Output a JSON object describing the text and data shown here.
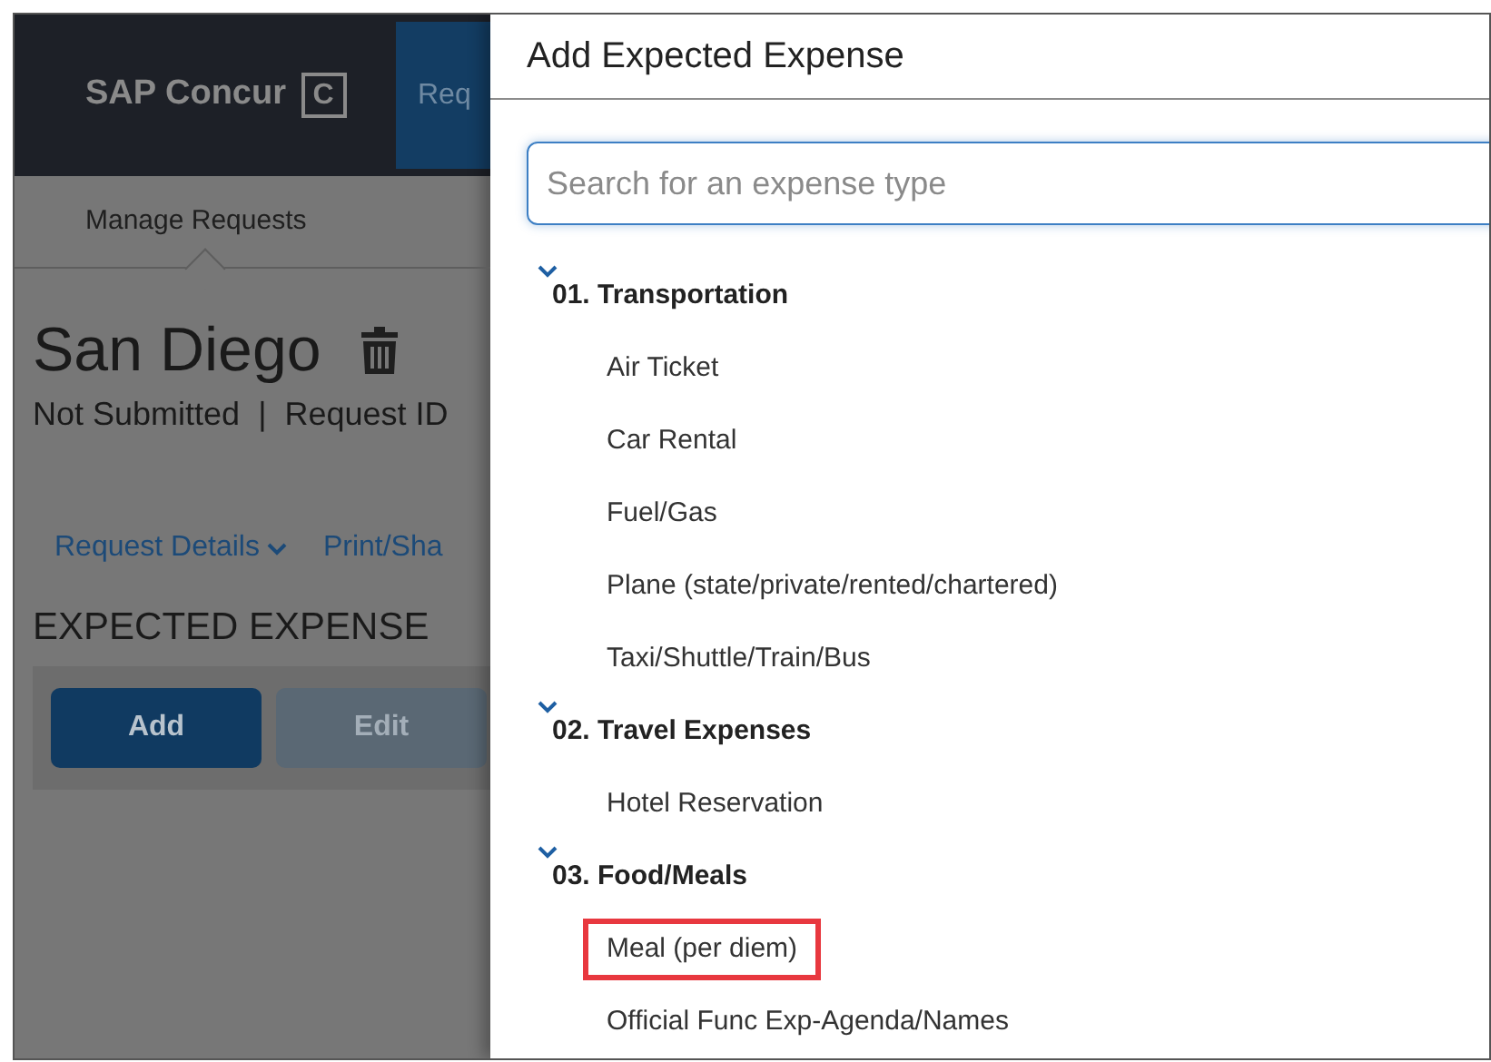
{
  "background_page": {
    "logo": "SAP Concur",
    "logo_mark": "C",
    "header_tab": "Req",
    "subnav": "Manage Requests",
    "title": "San Diego",
    "status": "Not Submitted",
    "separator": "|",
    "request_id_label": "Request ID",
    "links": [
      {
        "label": "Request Details",
        "dropdown": true
      },
      {
        "label": "Print/Sha",
        "dropdown": false
      }
    ],
    "section_title": "EXPECTED EXPENSE",
    "buttons": [
      {
        "label": "Add",
        "disabled": false
      },
      {
        "label": "Edit",
        "disabled": true
      }
    ]
  },
  "dialog": {
    "title": "Add Expected Expense",
    "search": {
      "placeholder": "Search for an expense type"
    },
    "groups": [
      {
        "label": "01. Transportation",
        "expanded": true,
        "children": [
          {
            "label": "Air Ticket",
            "highlighted": false
          },
          {
            "label": "Car Rental",
            "highlighted": false
          },
          {
            "label": "Fuel/Gas",
            "highlighted": false
          },
          {
            "label": "Plane (state/private/rented/chartered)",
            "highlighted": false
          },
          {
            "label": "Taxi/Shuttle/Train/Bus",
            "highlighted": false
          }
        ]
      },
      {
        "label": "02. Travel Expenses",
        "expanded": true,
        "children": [
          {
            "label": "Hotel Reservation",
            "highlighted": false
          }
        ]
      },
      {
        "label": "03. Food/Meals",
        "expanded": true,
        "children": [
          {
            "label": "Meal (per diem)",
            "highlighted": true
          },
          {
            "label": "Official Func Exp-Agenda/Names",
            "highlighted": false
          }
        ]
      }
    ]
  }
}
